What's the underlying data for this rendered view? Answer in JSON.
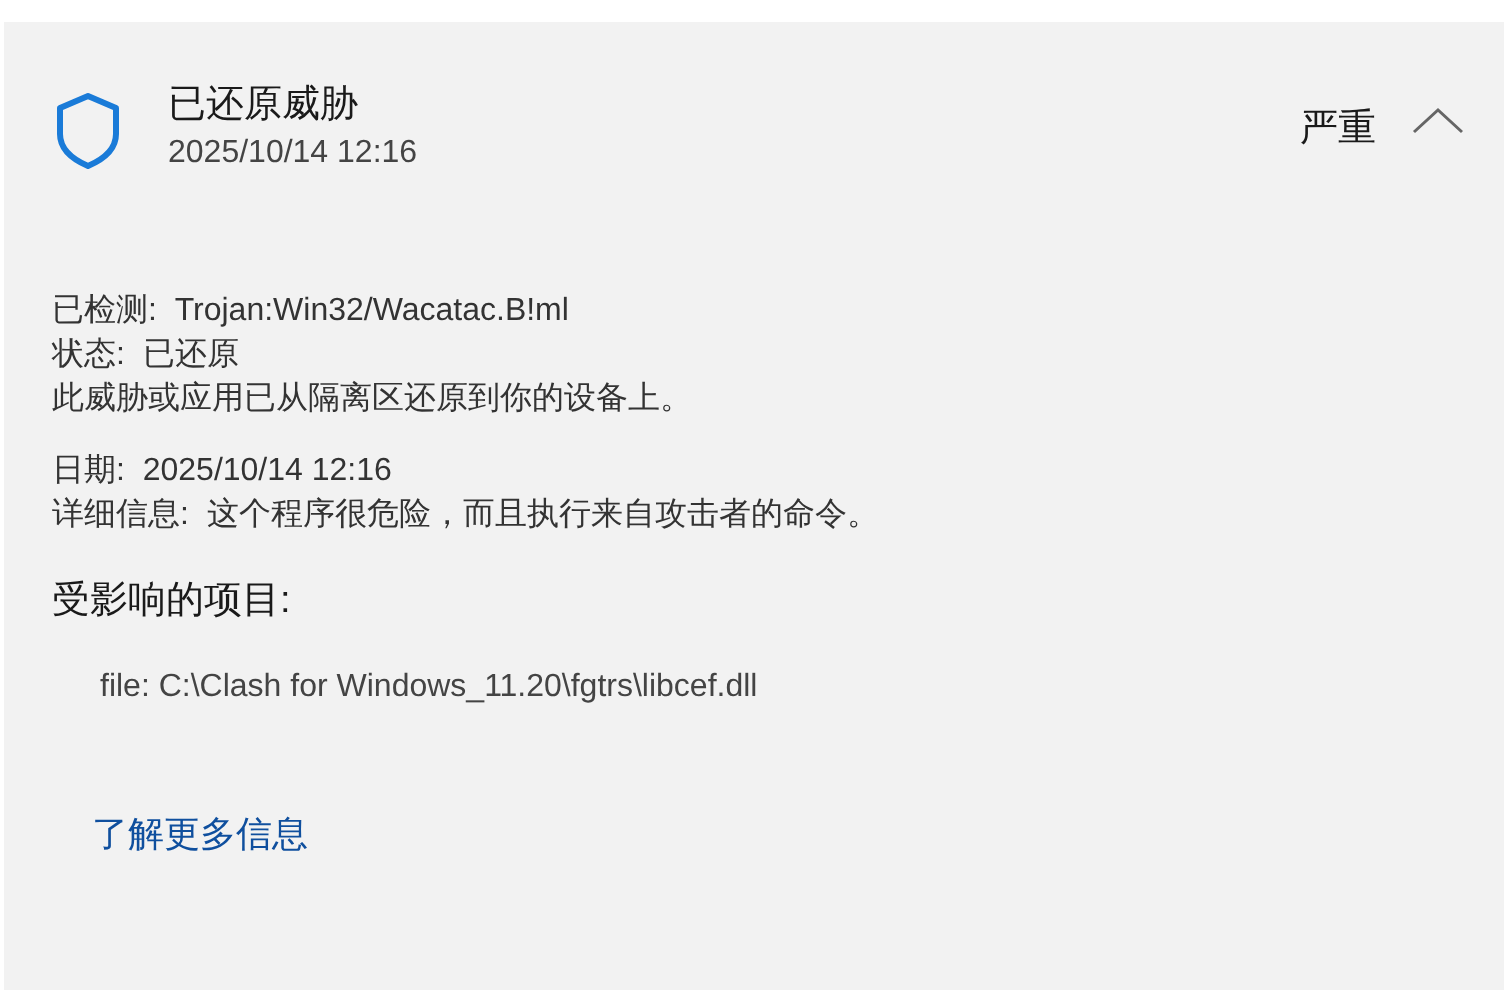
{
  "threat": {
    "title": "已还原威胁",
    "date": "2025/10/14 12:16",
    "severity": "严重",
    "expanded": true,
    "details": [
      {
        "label": "已检测:",
        "value": "Trojan:Win32/Wacatac.B!ml"
      },
      {
        "label": "状态:",
        "value": "已还原"
      }
    ],
    "note": "此威胁或应用已从隔离区还原到你的设备上。",
    "details_2": [
      {
        "label": "日期:",
        "value": "2025/10/14 12:16"
      },
      {
        "label": "详细信息:",
        "value": "这个程序很危险，而且执行来自攻击者的命令。"
      }
    ],
    "affected_heading": "受影响的项目:",
    "affected_items": [
      "file: C:\\Clash for Windows_11.20\\fgtrs\\libcef.dll"
    ],
    "link": "了解更多信息"
  }
}
